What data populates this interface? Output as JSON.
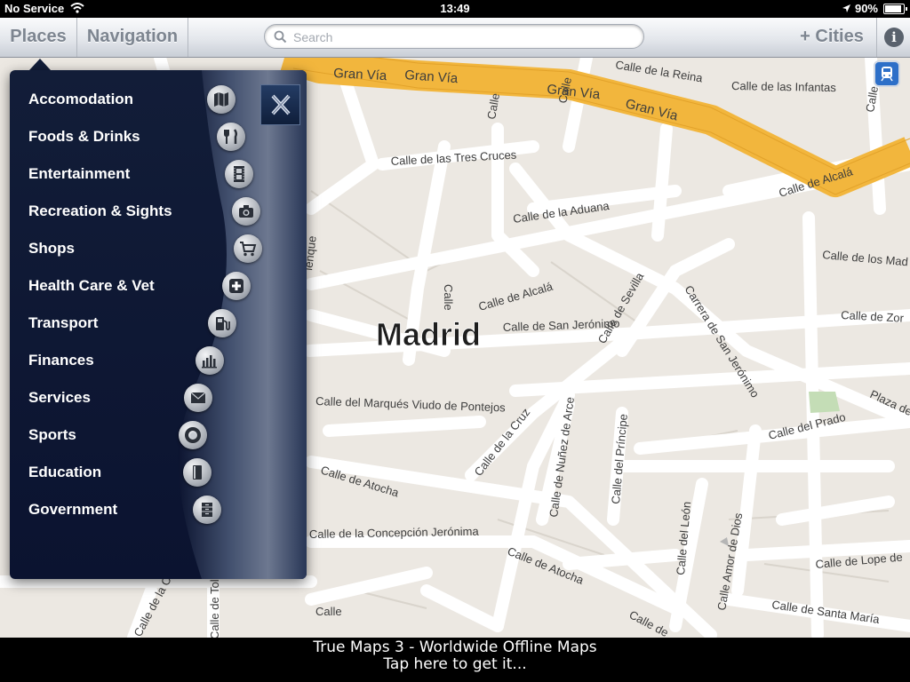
{
  "status_bar": {
    "carrier": "No Service",
    "time": "13:49",
    "battery": "90%",
    "battery_fraction": 0.9
  },
  "nav": {
    "places_label": "Places",
    "navigation_label": "Navigation",
    "search_placeholder": "Search",
    "search_value": "",
    "cities_label": "+ Cities",
    "info_icon": "info-icon"
  },
  "map": {
    "city": "Madrid",
    "streets": [
      "Gran Vía",
      "Gran Vía",
      "Gran Vía",
      "Gran Vía",
      "Calle de la Reina",
      "Calle de las Infantas",
      "Calle de las Tres Cruces",
      "Calle de Alcalá",
      "Calle de la Aduana",
      "Calle de los Mad",
      "Calle de Alcalá",
      "Calle de Zor",
      "Calle de San Jerónimo",
      "Calle de Sevilla",
      "Carrera de San Jerónimo",
      "Plaza de",
      "Calle del Marqués Viudo de Pontejos",
      "Calle de la Cruz",
      "Calle de Nuñez de Arce",
      "Calle del Príncipe",
      "Calle del Prado",
      "Calle de Atocha",
      "Calle de la Concepción Jerónima",
      "Calle de Atocha",
      "Calle del León",
      "Calle Amor de Dios",
      "Calle de Lope de",
      "Calle de Santa María",
      "Calle de",
      "Calle de la Cava",
      "Calle de Toled",
      "Calle",
      "Calle",
      "Calle",
      "Calle",
      "Calle",
      "lenque"
    ]
  },
  "places_menu": {
    "close_icon": "close-x-icon",
    "categories": [
      {
        "label": "Accomodation",
        "icon": "map-book-icon"
      },
      {
        "label": "Foods & Drinks",
        "icon": "fork-knife-icon"
      },
      {
        "label": "Entertainment",
        "icon": "film-icon"
      },
      {
        "label": "Recreation & Sights",
        "icon": "camera-icon"
      },
      {
        "label": "Shops",
        "icon": "shopping-cart-icon"
      },
      {
        "label": "Health Care & Vet",
        "icon": "medical-cross-icon"
      },
      {
        "label": "Transport",
        "icon": "fuel-pump-icon"
      },
      {
        "label": "Finances",
        "icon": "bar-chart-icon"
      },
      {
        "label": "Services",
        "icon": "envelope-icon"
      },
      {
        "label": "Sports",
        "icon": "life-ring-icon"
      },
      {
        "label": "Education",
        "icon": "book-icon"
      },
      {
        "label": "Government",
        "icon": "cabinet-icon"
      }
    ]
  },
  "banner": {
    "line1": "True Maps 3 - Worldwide Offline Maps",
    "line2": "Tap here to get it..."
  },
  "colors": {
    "menu_bg": "#0b1330",
    "major_road": "#f2b63d",
    "map_bg": "#ece8e2",
    "road": "#ffffff"
  }
}
